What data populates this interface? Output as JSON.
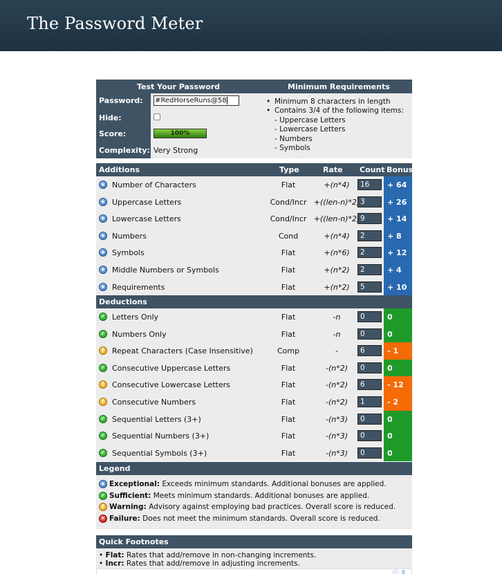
{
  "header": {
    "title": "The Password Meter"
  },
  "test": {
    "heading_left": "Test Your Password",
    "heading_right": "Minimum Requirements",
    "labels": {
      "password": "Password:",
      "hide": "Hide:",
      "score": "Score:",
      "complexity": "Complexity:"
    },
    "password_value": "#RedHorseRuns@58",
    "hide_checked": false,
    "score": "100%",
    "score_fraction": 1.0,
    "complexity": "Very Strong",
    "requirements": {
      "item1": "Minimum 8 characters in length",
      "item2": "Contains 3/4 of the following items:",
      "sub": [
        "- Uppercase Letters",
        "- Lowercase Letters",
        "- Numbers",
        "- Symbols"
      ]
    }
  },
  "additions": {
    "headers": {
      "name": "Additions",
      "type": "Type",
      "rate": "Rate",
      "count": "Count",
      "bonus": "Bonus"
    },
    "rows": [
      {
        "name": "Number of Characters",
        "type": "Flat",
        "rate": "+(n*4)",
        "count": "16",
        "bonus": "+ 64",
        "status": "exceptional"
      },
      {
        "name": "Uppercase Letters",
        "type": "Cond/Incr",
        "rate": "+((len-n)*2)",
        "count": "3",
        "bonus": "+ 26",
        "status": "exceptional"
      },
      {
        "name": "Lowercase Letters",
        "type": "Cond/Incr",
        "rate": "+((len-n)*2)",
        "count": "9",
        "bonus": "+ 14",
        "status": "exceptional"
      },
      {
        "name": "Numbers",
        "type": "Cond",
        "rate": "+(n*4)",
        "count": "2",
        "bonus": "+ 8",
        "status": "exceptional"
      },
      {
        "name": "Symbols",
        "type": "Flat",
        "rate": "+(n*6)",
        "count": "2",
        "bonus": "+ 12",
        "status": "exceptional"
      },
      {
        "name": "Middle Numbers or Symbols",
        "type": "Flat",
        "rate": "+(n*2)",
        "count": "2",
        "bonus": "+ 4",
        "status": "exceptional"
      },
      {
        "name": "Requirements",
        "type": "Flat",
        "rate": "+(n*2)",
        "count": "5",
        "bonus": "+ 10",
        "status": "exceptional"
      }
    ]
  },
  "deductions": {
    "heading": "Deductions",
    "rows": [
      {
        "name": "Letters Only",
        "type": "Flat",
        "rate": "-n",
        "count": "0",
        "bonus": "0",
        "status": "sufficient"
      },
      {
        "name": "Numbers Only",
        "type": "Flat",
        "rate": "-n",
        "count": "0",
        "bonus": "0",
        "status": "sufficient"
      },
      {
        "name": "Repeat Characters (Case Insensitive)",
        "type": "Comp",
        "rate": "-",
        "count": "6",
        "bonus": "- 1",
        "status": "warning"
      },
      {
        "name": "Consecutive Uppercase Letters",
        "type": "Flat",
        "rate": "-(n*2)",
        "count": "0",
        "bonus": "0",
        "status": "sufficient"
      },
      {
        "name": "Consecutive Lowercase Letters",
        "type": "Flat",
        "rate": "-(n*2)",
        "count": "6",
        "bonus": "- 12",
        "status": "warning"
      },
      {
        "name": "Consecutive Numbers",
        "type": "Flat",
        "rate": "-(n*2)",
        "count": "1",
        "bonus": "- 2",
        "status": "warning"
      },
      {
        "name": "Sequential Letters (3+)",
        "type": "Flat",
        "rate": "-(n*3)",
        "count": "0",
        "bonus": "0",
        "status": "sufficient"
      },
      {
        "name": "Sequential Numbers (3+)",
        "type": "Flat",
        "rate": "-(n*3)",
        "count": "0",
        "bonus": "0",
        "status": "sufficient"
      },
      {
        "name": "Sequential Symbols (3+)",
        "type": "Flat",
        "rate": "-(n*3)",
        "count": "0",
        "bonus": "0",
        "status": "sufficient"
      }
    ]
  },
  "legend": {
    "heading": "Legend",
    "items": [
      {
        "term": "Exceptional:",
        "desc": "Exceeds minimum standards. Additional bonuses are applied.",
        "icon": "exceptional-icon"
      },
      {
        "term": "Sufficient:",
        "desc": "Meets minimum standards. Additional bonuses are applied.",
        "icon": "sufficient-icon"
      },
      {
        "term": "Warning:",
        "desc": "Advisory against employing bad practices. Overall score is reduced.",
        "icon": "warning-icon"
      },
      {
        "term": "Failure:",
        "desc": "Does not meet the minimum standards. Overall score is reduced.",
        "icon": "failure-icon"
      }
    ]
  },
  "footnotes": {
    "heading": "Quick Footnotes",
    "items": [
      {
        "term": "Flat:",
        "desc": "Rates that add/remove in non-changing increments."
      },
      {
        "term": "Incr:",
        "desc": "Rates that add/remove in adjusting increments."
      }
    ]
  },
  "colors": {
    "header": "#1d3242",
    "bar": "#3f5364",
    "bonus_blue": "#2869b0",
    "bonus_green": "#1f9a2a",
    "bonus_orange": "#f46b08"
  }
}
